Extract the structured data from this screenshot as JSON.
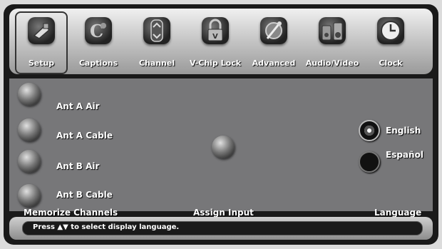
{
  "tabs": [
    {
      "label": "Setup",
      "icon": "setup-icon",
      "active": true
    },
    {
      "label": "Captions",
      "icon": "captions-icon",
      "active": false
    },
    {
      "label": "Channel",
      "icon": "channel-icon",
      "active": false
    },
    {
      "label": "V-Chip Lock",
      "icon": "lock-icon",
      "active": false
    },
    {
      "label": "Advanced",
      "icon": "advanced-icon",
      "active": false
    },
    {
      "label": "Audio/Video",
      "icon": "speakers-icon",
      "active": false
    },
    {
      "label": "Clock",
      "icon": "clock-icon",
      "active": false
    }
  ],
  "memorize": {
    "heading": "Memorize Channels",
    "options": [
      "Ant A Air",
      "Ant A Cable",
      "Ant B Air",
      "Ant B Cable"
    ]
  },
  "assign": {
    "heading": "Assign Input"
  },
  "language": {
    "heading": "Language",
    "options": [
      {
        "label": "English",
        "selected": true
      },
      {
        "label": "Español",
        "selected": false
      }
    ]
  },
  "status": {
    "text": "Press ▲▼ to select display language."
  }
}
